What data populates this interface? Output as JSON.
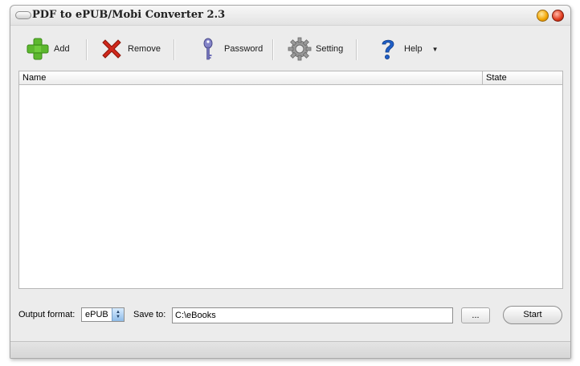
{
  "window": {
    "title": "PDF to ePUB/Mobi Converter 2.3"
  },
  "toolbar": {
    "add_label": "Add",
    "remove_label": "Remove",
    "password_label": "Password",
    "setting_label": "Setting",
    "help_label": "Help",
    "help_dropdown_icon": "chevron-down-icon"
  },
  "file_list": {
    "columns": [
      "Name",
      "State"
    ],
    "rows": []
  },
  "options": {
    "output_format_label": "Output format:",
    "output_format_value": "ePUB",
    "save_to_label": "Save to:",
    "save_to_value": "C:\\eBooks",
    "browse_label": "...",
    "start_label": "Start"
  },
  "colors": {
    "add_icon": "#5db82f",
    "remove_icon": "#d0281c",
    "password_icon": "#7070b8",
    "help_icon": "#1f5fc8"
  }
}
